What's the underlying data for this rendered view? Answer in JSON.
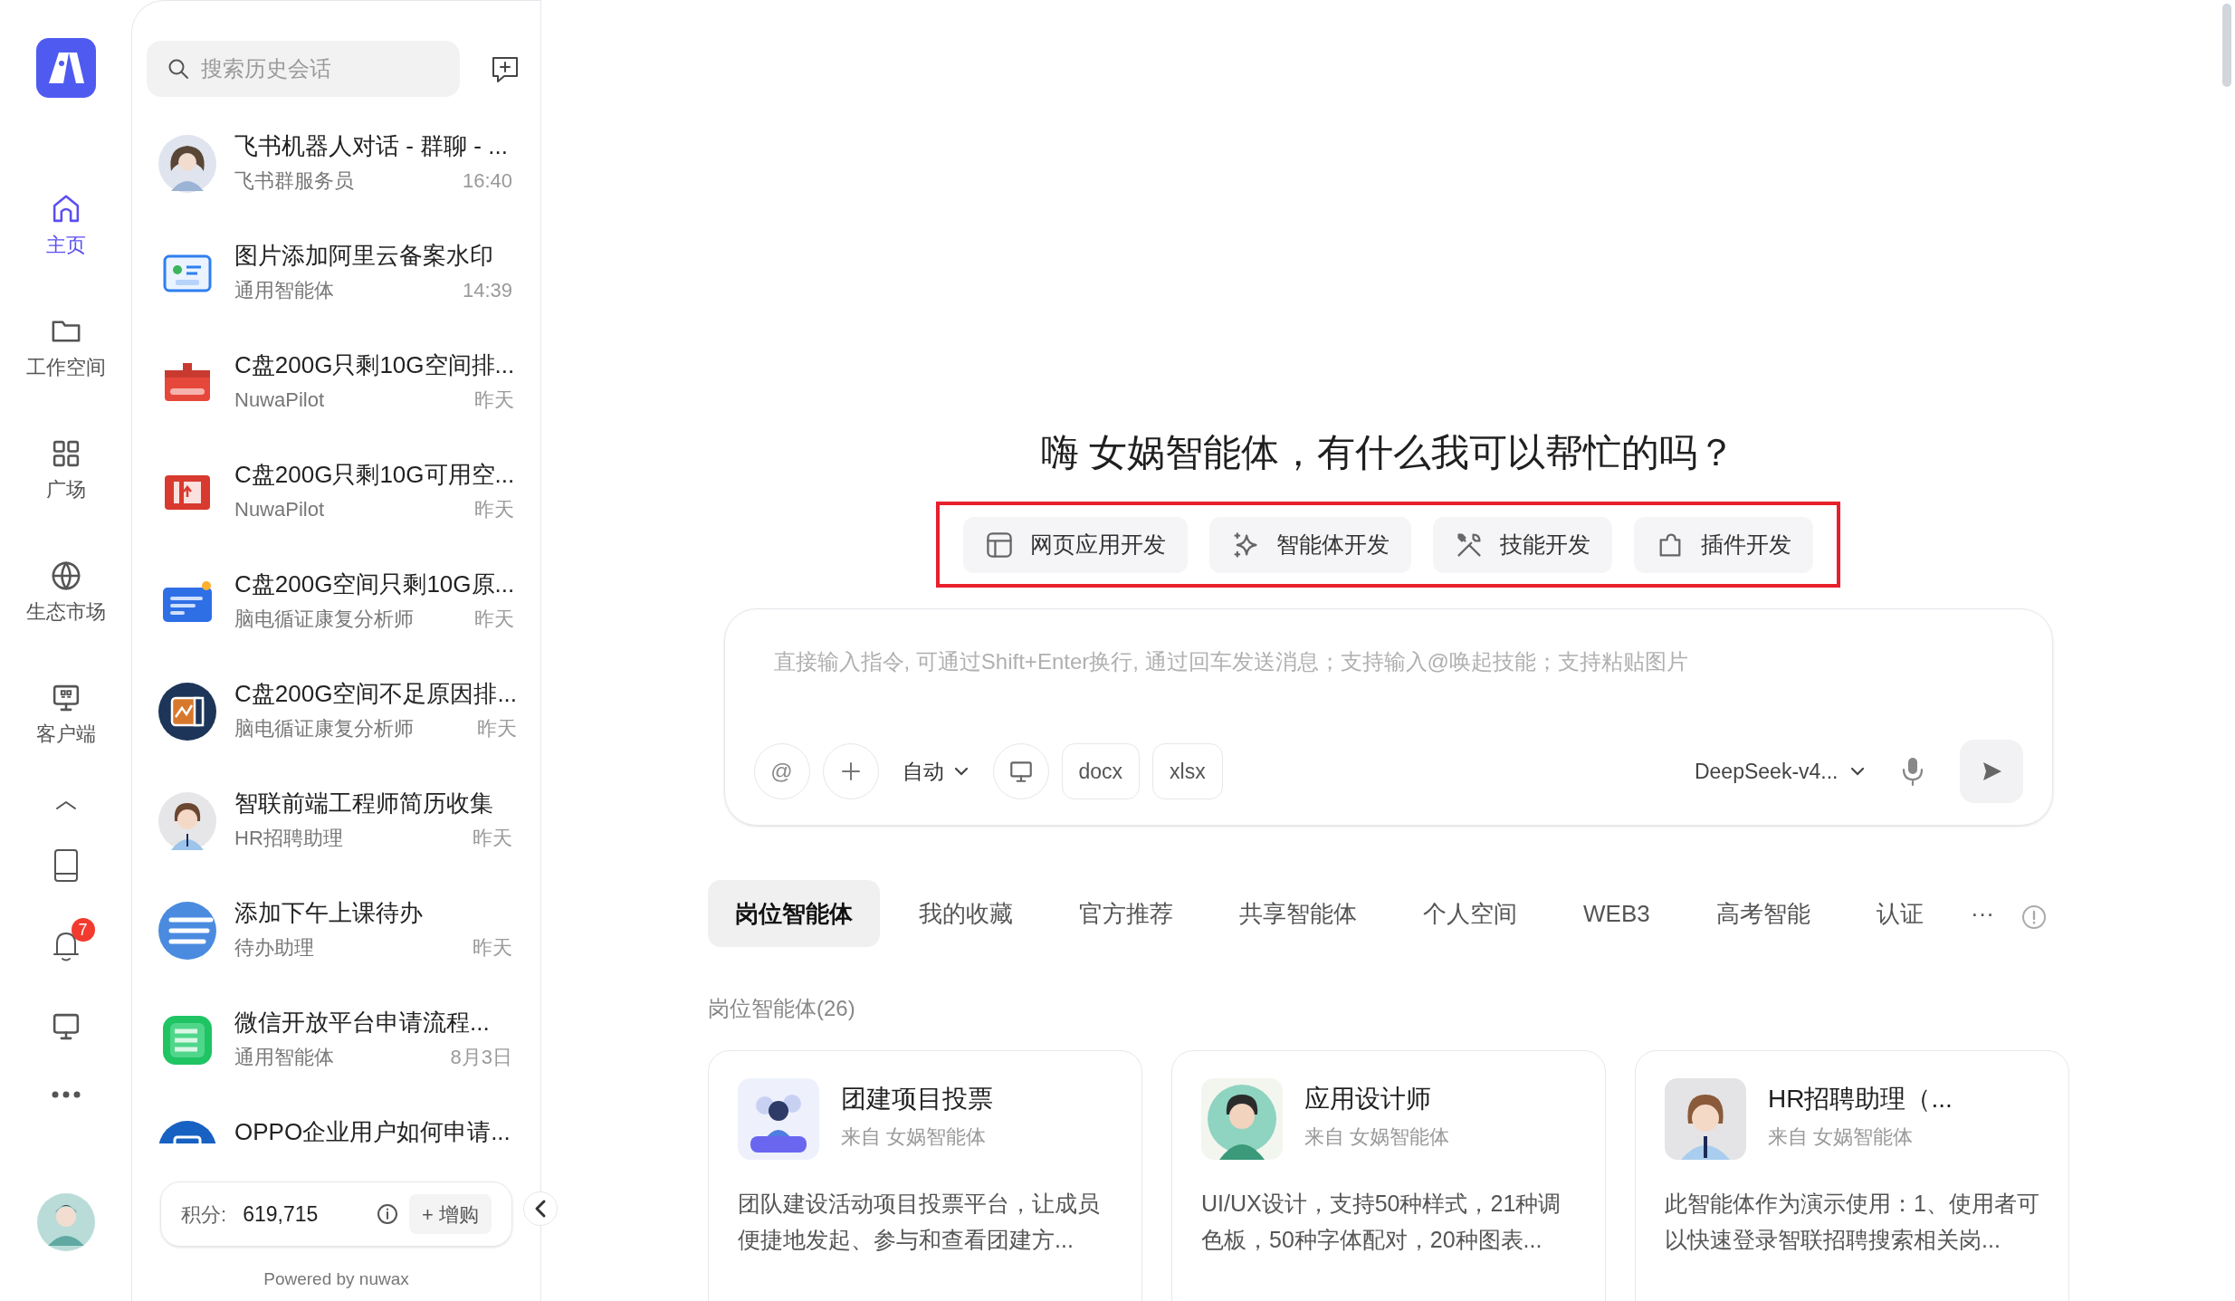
{
  "rail": {
    "nav": [
      {
        "label": "主页",
        "selected": true
      },
      {
        "label": "工作空间",
        "selected": false
      },
      {
        "label": "广场",
        "selected": false
      },
      {
        "label": "生态市场",
        "selected": false
      },
      {
        "label": "客户端",
        "selected": false
      }
    ],
    "notification_count": "7"
  },
  "history": {
    "search": {
      "placeholder": "搜索历史会话"
    },
    "items": [
      {
        "title": "飞书机器人对话 - 群聊 - ...",
        "agent": "飞书群服务员",
        "time": "16:40"
      },
      {
        "title": "图片添加阿里云备案水印",
        "agent": "通用智能体",
        "time": "14:39"
      },
      {
        "title": "C盘200G只剩10G空间排...",
        "agent": "NuwaPilot",
        "time": "昨天"
      },
      {
        "title": "C盘200G只剩10G可用空...",
        "agent": "NuwaPilot",
        "time": "昨天"
      },
      {
        "title": "C盘200G空间只剩10G原...",
        "agent": "脑电循证康复分析师",
        "time": "昨天"
      },
      {
        "title": "C盘200G空间不足原因排...",
        "agent": "脑电循证康复分析师",
        "time": "昨天"
      },
      {
        "title": "智联前端工程师简历收集",
        "agent": "HR招聘助理",
        "time": "昨天"
      },
      {
        "title": "添加下午上课待办",
        "agent": "待办助理",
        "time": "昨天"
      },
      {
        "title": "微信开放平台申请流程...",
        "agent": "通用智能体",
        "time": "8月3日"
      },
      {
        "title": "OPPO企业用户如何申请..."
      }
    ]
  },
  "points": {
    "label": "积分:",
    "value": "619,715",
    "buy": "+ 增购"
  },
  "powered_by": "Powered by nuwax",
  "main": {
    "greeting": "嗨 女娲智能体，有什么我可以帮忙的吗？",
    "quick_actions": [
      "网页应用开发",
      "智能体开发",
      "技能开发",
      "插件开发"
    ],
    "composer": {
      "placeholder": "直接输入指令, 可通过Shift+Enter换行, 通过回车发送消息；支持输入@唤起技能；支持粘贴图片",
      "mention": "@",
      "mode": "自动",
      "file_types": [
        "docx",
        "xlsx"
      ],
      "model": "DeepSeek-v4..."
    },
    "tabs": [
      {
        "label": "岗位智能体",
        "selected": true
      },
      {
        "label": "我的收藏",
        "selected": false
      },
      {
        "label": "官方推荐",
        "selected": false
      },
      {
        "label": "共享智能体",
        "selected": false
      },
      {
        "label": "个人空间",
        "selected": false
      },
      {
        "label": "WEB3",
        "selected": false
      },
      {
        "label": "高考智能",
        "selected": false
      },
      {
        "label": "认证",
        "selected": false
      }
    ],
    "more": "···",
    "section_title": "岗位智能体(26)",
    "cards": [
      {
        "title": "团建项目投票",
        "source": "来自 女娲智能体",
        "description": "团队建设活动项目投票平台，让成员便捷地发起、参与和查看团建方..."
      },
      {
        "title": "应用设计师",
        "source": "来自 女娲智能体",
        "description": "UI/UX设计，支持50种样式，21种调色板，50种字体配对，20种图表..."
      },
      {
        "title": "HR招聘助理（...",
        "source": "来自 女娲智能体",
        "description": "此智能体作为演示使用：1、使用者可以快速登录智联招聘搜索相关岗..."
      }
    ]
  }
}
